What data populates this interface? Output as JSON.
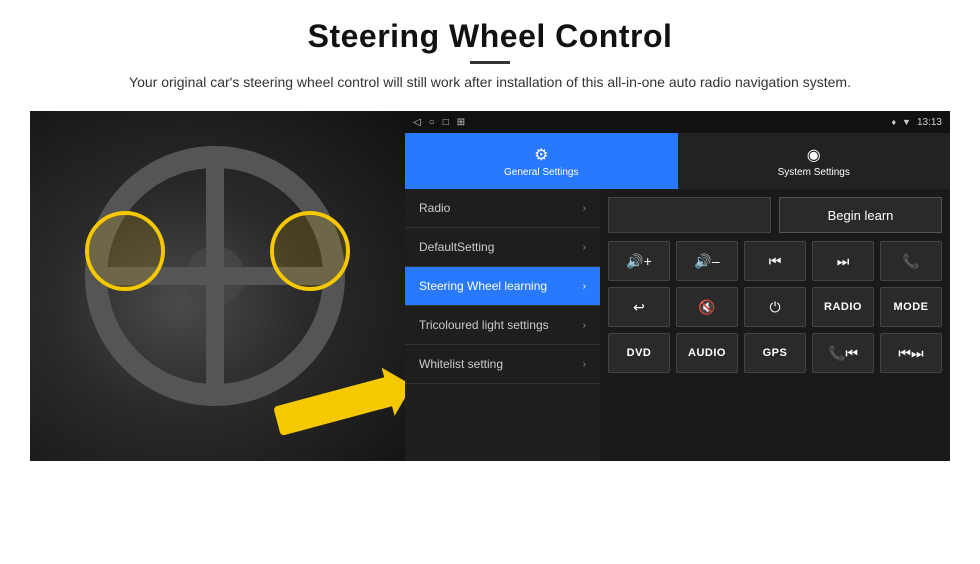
{
  "header": {
    "title": "Steering Wheel Control",
    "divider": true,
    "subtitle": "Your original car's steering wheel control will still work after installation of this all-in-one auto radio navigation system."
  },
  "status_bar": {
    "left_icons": [
      "◁",
      "○",
      "□",
      "⊞"
    ],
    "right_text": "13:13",
    "signal_icon": "♦",
    "wifi_icon": "▼"
  },
  "tabs": [
    {
      "label": "General Settings",
      "icon": "⚙",
      "active": true
    },
    {
      "label": "System Settings",
      "icon": "⊕",
      "active": false
    }
  ],
  "menu_items": [
    {
      "label": "Radio",
      "active": false
    },
    {
      "label": "DefaultSetting",
      "active": false
    },
    {
      "label": "Steering Wheel learning",
      "active": true
    },
    {
      "label": "Tricoloured light settings",
      "active": false
    },
    {
      "label": "Whitelist setting",
      "active": false
    }
  ],
  "right_panel": {
    "begin_learn_label": "Begin learn",
    "icons_row1": [
      "◀◀+",
      "◀◀–",
      "◀◀",
      "▶▶",
      "☎"
    ],
    "icons_row2": [
      "↩",
      "◀◀×",
      "⏻",
      "RADIO",
      "MODE"
    ],
    "icons_row3": [
      "DVD",
      "AUDIO",
      "GPS",
      "☎◀◀",
      "◀◀▶▶"
    ]
  }
}
